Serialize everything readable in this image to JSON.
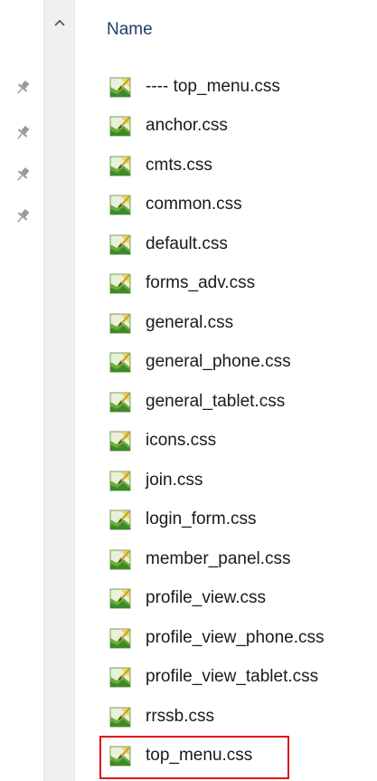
{
  "header": {
    "name_label": "Name"
  },
  "files": [
    "---- top_menu.css",
    "anchor.css",
    "cmts.css",
    "common.css",
    "default.css",
    "forms_adv.css",
    "general.css",
    "general_phone.css",
    "general_tablet.css",
    "icons.css",
    "join.css",
    "login_form.css",
    "member_panel.css",
    "profile_view.css",
    "profile_view_phone.css",
    "profile_view_tablet.css",
    "rrssb.css",
    "top_menu.css"
  ],
  "pins": [
    "pin-icon",
    "pin-icon",
    "pin-icon",
    "pin-icon"
  ],
  "icons": {
    "file": "css-file-icon",
    "scroll_up": "chevron-up-icon"
  },
  "colors": {
    "header_text": "#1f3f6e",
    "highlight": "#e0101d",
    "scroll_strip": "#f0f0f0"
  },
  "highlighted_file": "top_menu.css"
}
